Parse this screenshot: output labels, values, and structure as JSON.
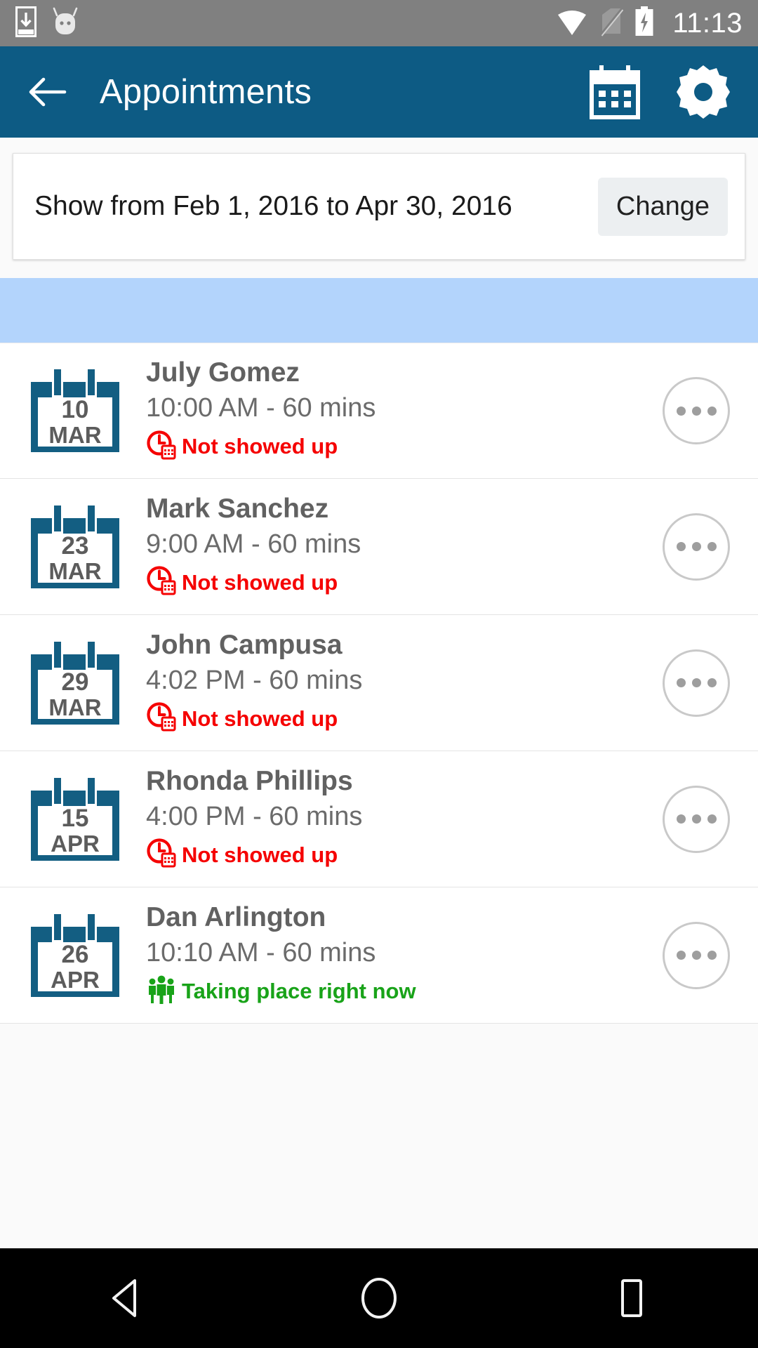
{
  "status_bar": {
    "icons": [
      "download-icon",
      "android-mascot-icon",
      "wifi-icon",
      "no-sim-icon",
      "battery-charging-icon"
    ],
    "time": "11:13"
  },
  "app_bar": {
    "back_label": "back-arrow",
    "title": "Appointments",
    "actions": [
      "calendar-icon",
      "settings-gear-icon"
    ]
  },
  "date_range": {
    "text": "Show from Feb 1, 2016 to Apr 30, 2016",
    "change_label": "Change"
  },
  "banner": {
    "text": ""
  },
  "colors": {
    "appbar": "#0d5b84",
    "calendar_icon": "#135e82",
    "banner": "#b3d4fc",
    "status_missed": "#f50000",
    "status_now": "#19a319",
    "statusbar": "#808080"
  },
  "appointments": [
    {
      "day": "10",
      "month": "MAR",
      "name": "July Gomez",
      "time": "10:00 AM - 60 mins",
      "status": "Not showed up",
      "status_type": "missed",
      "status_icon": "clock-calendar-icon"
    },
    {
      "day": "23",
      "month": "MAR",
      "name": "Mark Sanchez",
      "time": "9:00 AM - 60 mins",
      "status": "Not showed up",
      "status_type": "missed",
      "status_icon": "clock-calendar-icon"
    },
    {
      "day": "29",
      "month": "MAR",
      "name": "John Campusa",
      "time": "4:02 PM - 60 mins",
      "status": "Not showed up",
      "status_type": "missed",
      "status_icon": "clock-calendar-icon"
    },
    {
      "day": "15",
      "month": "APR",
      "name": "Rhonda Phillips",
      "time": "4:00 PM - 60 mins",
      "status": "Not showed up",
      "status_type": "missed",
      "status_icon": "clock-calendar-icon"
    },
    {
      "day": "26",
      "month": "APR",
      "name": "Dan Arlington",
      "time": "10:10 AM - 60 mins",
      "status": "Taking place right now",
      "status_type": "now",
      "status_icon": "people-group-icon"
    }
  ],
  "nav_bar": {
    "back": "back-triangle-icon",
    "home": "home-circle-icon",
    "recents": "recents-square-icon"
  }
}
